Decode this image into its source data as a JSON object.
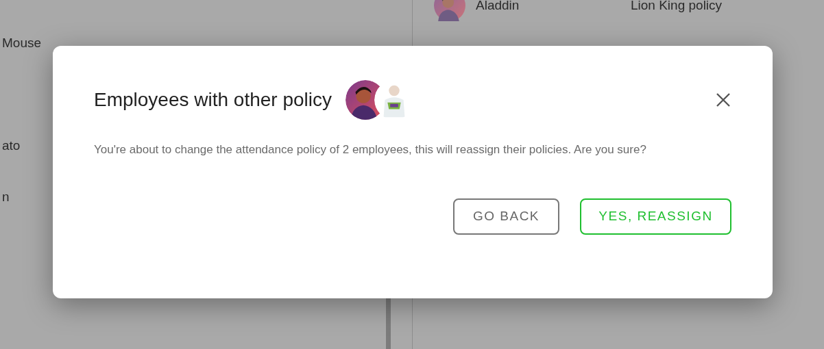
{
  "background": {
    "left_rows": [
      {
        "name": "Mouse"
      },
      {},
      {
        "name": "ato"
      },
      {
        "name": "n"
      }
    ],
    "right_rows": [
      {
        "name": "Aladdin",
        "policy": "Lion King policy"
      }
    ]
  },
  "dialog": {
    "title": "Employees with other policy",
    "message": "You're about to change the attendance policy of 2 employees, this will reassign their policies. Are you sure?",
    "buttons": [
      {
        "label": "GO BACK",
        "kind": "secondary"
      },
      {
        "label": "YES, REASSIGN",
        "kind": "primary"
      }
    ]
  }
}
